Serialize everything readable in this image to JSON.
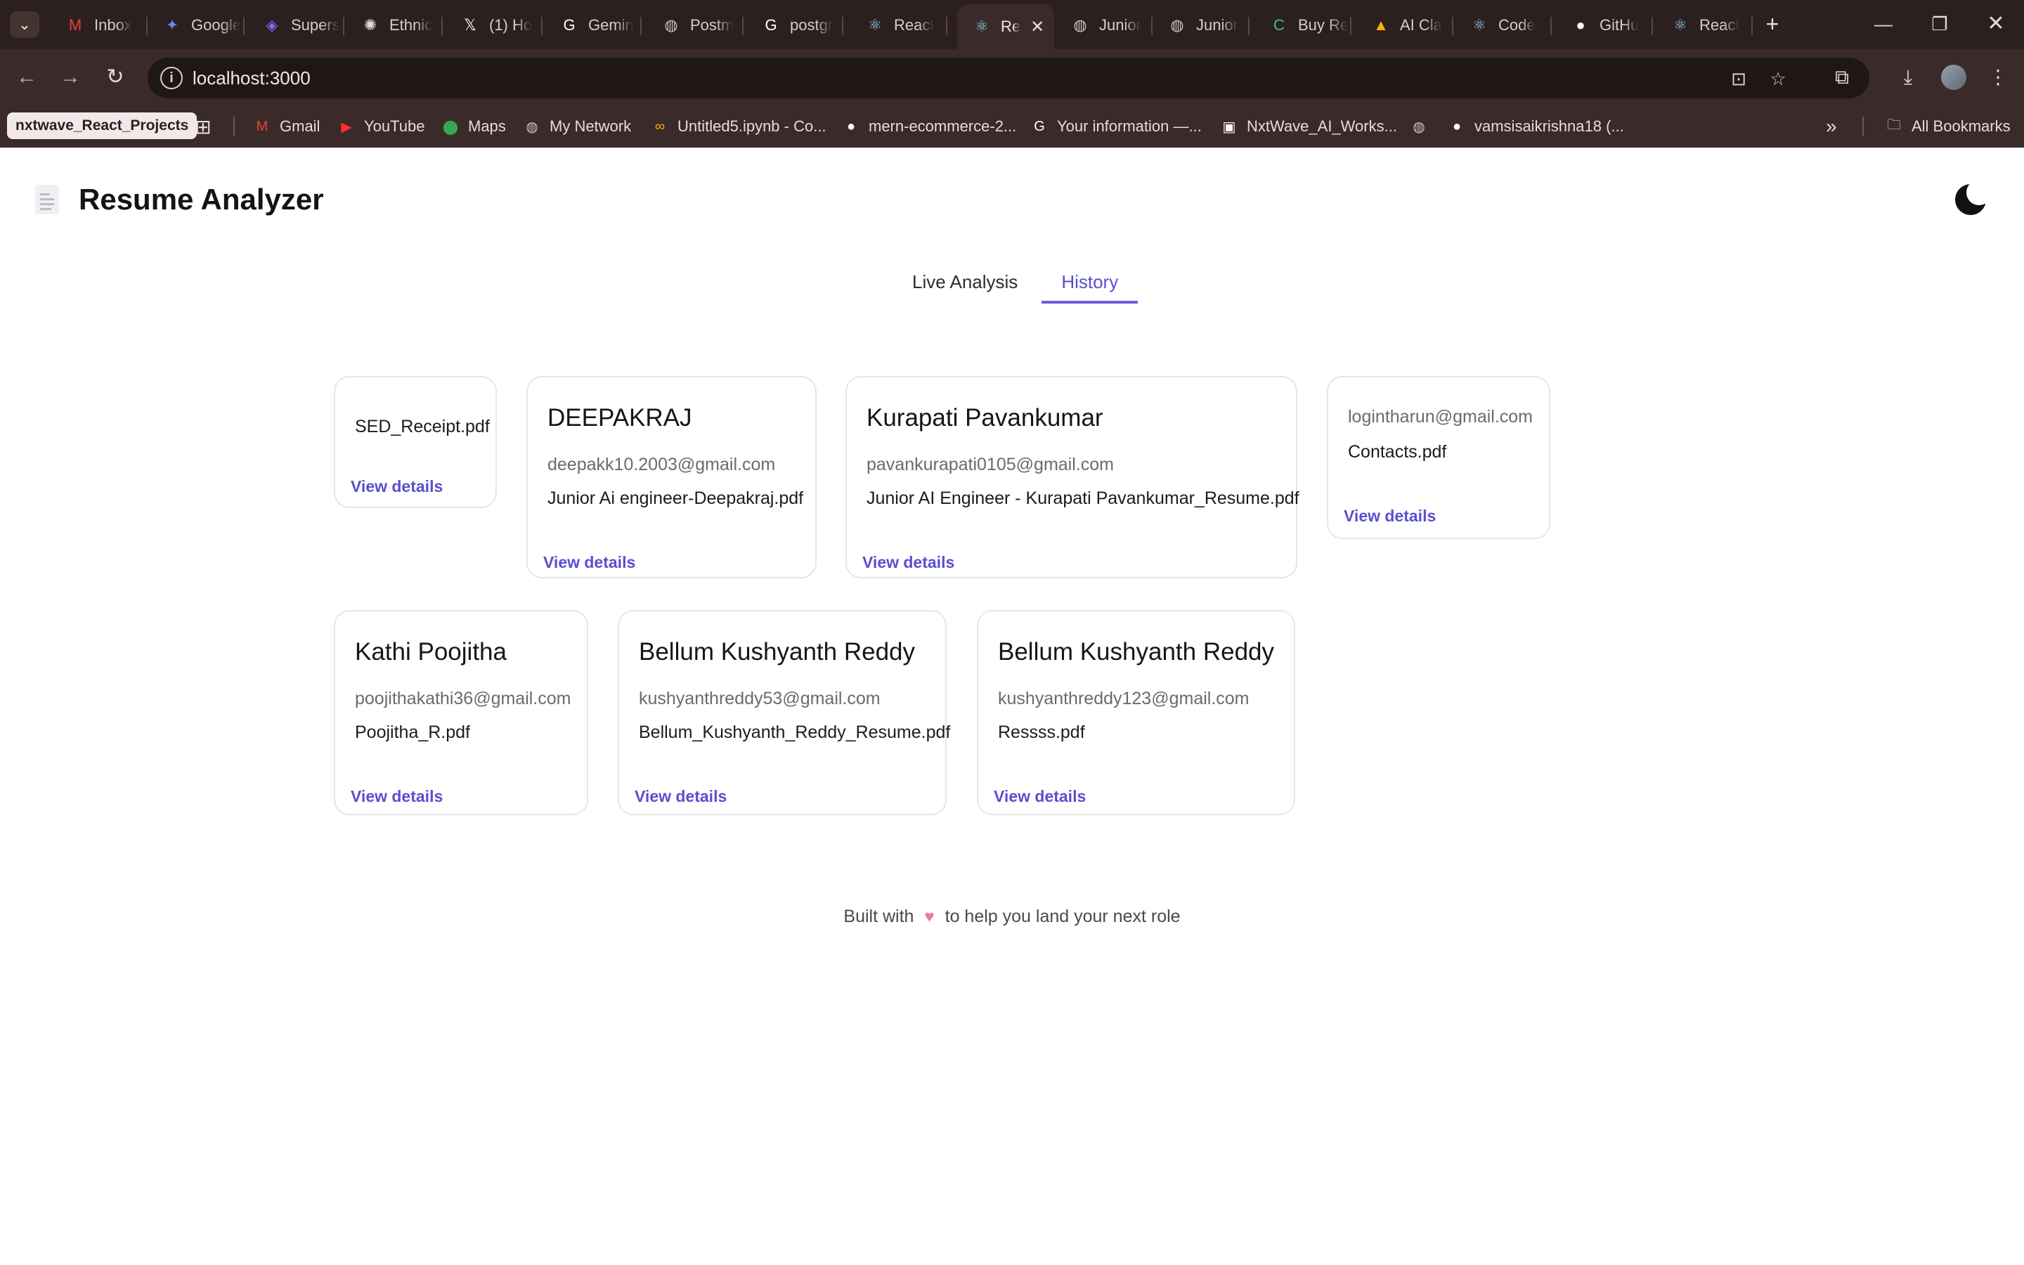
{
  "browser": {
    "tabs": [
      {
        "title": "Inbox",
        "icon": "gmail-icon",
        "glyph": "M",
        "color": "#ea4335"
      },
      {
        "title": "Google",
        "icon": "gemini-star-icon",
        "glyph": "✦",
        "color": "#5b8def"
      },
      {
        "title": "Supers",
        "icon": "supers-icon",
        "glyph": "◈",
        "color": "#7a6cff"
      },
      {
        "title": "Ethnic",
        "icon": "openai-icon",
        "glyph": "✺",
        "color": "#e6dada"
      },
      {
        "title": "(1) Ho",
        "icon": "x-icon",
        "glyph": "𝕏",
        "color": "#ffffff"
      },
      {
        "title": "Gemin",
        "icon": "google-icon",
        "glyph": "G",
        "color": "#ffffff"
      },
      {
        "title": "Postm",
        "icon": "globe-icon",
        "glyph": "◍",
        "color": "#cfc3c3"
      },
      {
        "title": "postgr",
        "icon": "google-icon",
        "glyph": "G",
        "color": "#ffffff"
      },
      {
        "title": "React",
        "icon": "react-icon",
        "glyph": "⚛",
        "color": "#8fd6f0"
      },
      {
        "title": "Re",
        "icon": "react-icon",
        "glyph": "⚛",
        "color": "#8fd6f0"
      },
      {
        "title": "Junior",
        "icon": "globe-icon",
        "glyph": "◍",
        "color": "#cfc3c3"
      },
      {
        "title": "Junior",
        "icon": "globe-icon",
        "glyph": "◍",
        "color": "#cfc3c3"
      },
      {
        "title": "Buy Re",
        "icon": "buy-icon",
        "glyph": "C",
        "color": "#34c38f"
      },
      {
        "title": "AI Cla",
        "icon": "drive-icon",
        "glyph": "▲",
        "color": "#f4b400"
      },
      {
        "title": "Code",
        "icon": "react-icon",
        "glyph": "⚛",
        "color": "#8fd6f0"
      },
      {
        "title": "GitHu",
        "icon": "github-icon",
        "glyph": "●",
        "color": "#ffffff"
      },
      {
        "title": "React",
        "icon": "react-icon",
        "glyph": "⚛",
        "color": "#8fd6f0"
      }
    ],
    "url": "localhost:3000",
    "bookmarks": [
      {
        "label": "Gmail",
        "icon": "gmail-icon",
        "glyph": "M",
        "color": "#ea4335"
      },
      {
        "label": "YouTube",
        "icon": "youtube-icon",
        "glyph": "▶",
        "color": "#ff2d2d"
      },
      {
        "label": "Maps",
        "icon": "maps-icon",
        "glyph": "⬤",
        "color": "#34a853"
      },
      {
        "label": "My Network",
        "icon": "globe-icon",
        "glyph": "◍",
        "color": "#cfc3c3"
      },
      {
        "label": "Untitled5.ipynb - Co...",
        "icon": "colab-icon",
        "glyph": "∞",
        "color": "#f9ab00"
      },
      {
        "label": "mern-ecommerce-2...",
        "icon": "github-icon",
        "glyph": "●",
        "color": "#ffffff"
      },
      {
        "label": "Your information —...",
        "icon": "google-icon",
        "glyph": "G",
        "color": "#ffffff"
      },
      {
        "label": "NxtWave_AI_Works...",
        "icon": "nxtwave-icon",
        "glyph": "▣",
        "color": "#ffffff"
      },
      {
        "label": "",
        "icon": "globe-icon",
        "glyph": "◍",
        "color": "#cfc3c3"
      },
      {
        "label": "vamsisaikrishna18 (...",
        "icon": "github-icon",
        "glyph": "●",
        "color": "#ffffff"
      }
    ],
    "bookmark_folder": "nxtwave_React_Projects",
    "all_bookmarks": "All Bookmarks"
  },
  "app": {
    "title": "Resume Analyzer",
    "tabs": [
      "Live Analysis",
      "History"
    ],
    "active_tab": "History",
    "accent": "#5a4fcf",
    "cards": [
      {
        "name": "",
        "email": "",
        "file": "SED_Receipt.pdf",
        "action": "View details"
      },
      {
        "name": "DEEPAKRAJ",
        "email": "deepakk10.2003@gmail.com",
        "file": "Junior Ai engineer-Deepakraj.pdf",
        "action": "View details"
      },
      {
        "name": "Kurapati Pavankumar",
        "email": "pavankurapati0105@gmail.com",
        "file": "Junior AI Engineer - Kurapati Pavankumar_Resume.pdf",
        "action": "View details"
      },
      {
        "name": "",
        "email": "logintharun@gmail.com",
        "file": "Contacts.pdf",
        "action": "View details"
      },
      {
        "name": "Kathi Poojitha",
        "email": "poojithakathi36@gmail.com",
        "file": "Poojitha_R.pdf",
        "action": "View details"
      },
      {
        "name": "Bellum Kushyanth Reddy",
        "email": "kushyanthreddy53@gmail.com",
        "file": "Bellum_Kushyanth_Reddy_Resume.pdf",
        "action": "View details"
      },
      {
        "name": "Bellum Kushyanth Reddy",
        "email": "kushyanthreddy123@gmail.com",
        "file": "Ressss.pdf",
        "action": "View details"
      }
    ],
    "footer": {
      "before": "Built with",
      "after": "to help you land your next role"
    }
  }
}
